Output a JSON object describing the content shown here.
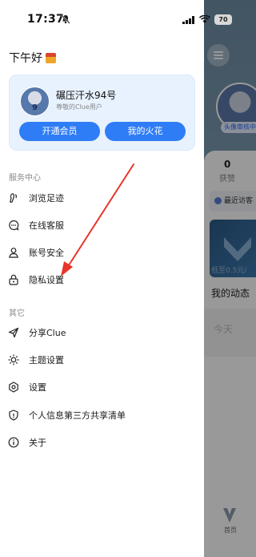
{
  "status_bar": {
    "time": "17:37",
    "battery": "70"
  },
  "drawer": {
    "greeting": "下午好",
    "profile": {
      "name": "碾压汗水94号",
      "subtitle": "尊敬的Clue用户",
      "avatar_number": "9",
      "buttons": {
        "vip": "开通会员",
        "spark": "我的火花"
      }
    },
    "service_section": {
      "title": "服务中心",
      "items": [
        {
          "label": "浏览足迹",
          "icon": "footprint-icon"
        },
        {
          "label": "在线客服",
          "icon": "chat-icon"
        },
        {
          "label": "账号安全",
          "icon": "user-icon"
        },
        {
          "label": "隐私设置",
          "icon": "lock-icon"
        }
      ]
    },
    "other_section": {
      "title": "其它",
      "items": [
        {
          "label": "分享Clue",
          "icon": "send-icon"
        },
        {
          "label": "主题设置",
          "icon": "sun-icon"
        },
        {
          "label": "设置",
          "icon": "gear-icon"
        },
        {
          "label": "个人信息第三方共享清单",
          "icon": "shield-icon"
        },
        {
          "label": "关于",
          "icon": "info-icon"
        }
      ]
    }
  },
  "background": {
    "avatar_tag": "头像审核中",
    "stat_num": "0",
    "stat_label": "获赞",
    "visitor_label": "最近访客",
    "ad_label": "低至0.5元/",
    "my_posts": "我的动态",
    "today": "今天",
    "tab_home": "首页"
  },
  "colors": {
    "accent": "#2f7df6",
    "annotation": "#e8352b"
  }
}
